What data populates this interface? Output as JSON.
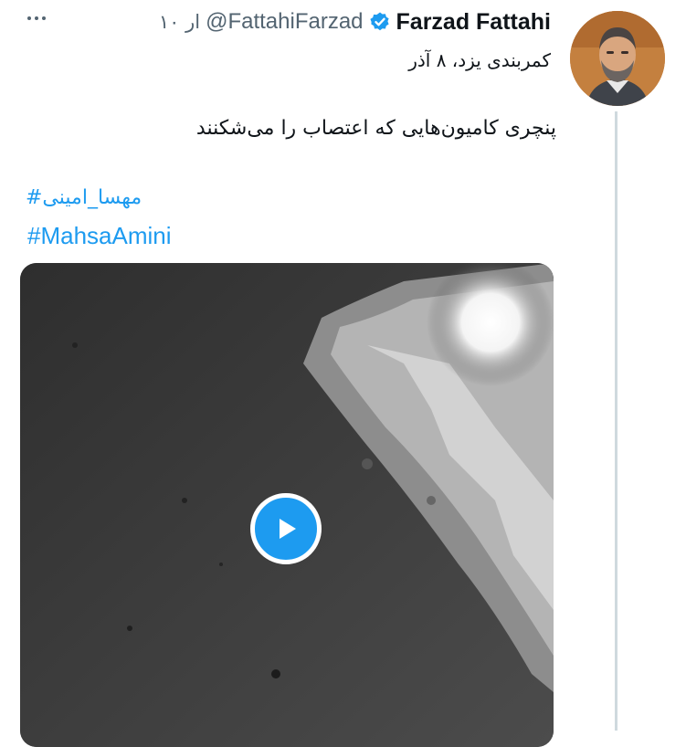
{
  "tweet": {
    "author_name": "Farzad Fattahi",
    "handle": "@FattahiFarzad",
    "time": "۱۰ ار",
    "location_line": "کمربندی یزد، ۸ آذر",
    "text": "پنچری کامیون‌هایی که اعتصاب را می‌شکنند",
    "hashtags": [
      "مهسا_امینی#",
      "#MahsaAmini"
    ],
    "verified": true,
    "icons": [
      "more-icon",
      "verified-icon",
      "play-icon"
    ],
    "colors": {
      "link": "#1d9bf0",
      "secondary_text": "#536471",
      "verified": "#1d9bf0"
    }
  }
}
